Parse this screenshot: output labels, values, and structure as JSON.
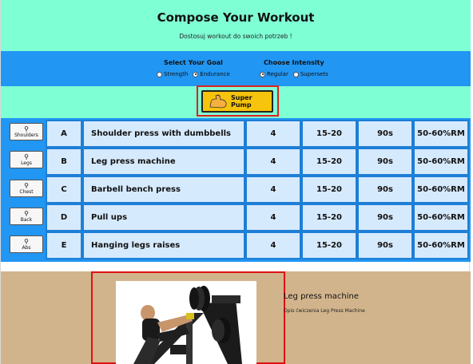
{
  "header": {
    "title": "Compose Your Workout",
    "subtitle": "Dostosuj workout do swoich potrzeb !"
  },
  "goal": {
    "title": "Select Your Goal",
    "options": [
      "Strength",
      "Endurance"
    ],
    "selected": "Endurance"
  },
  "intensity": {
    "title": "Choose Intensity",
    "options": [
      "Regular",
      "Supersets"
    ],
    "selected": "Regular"
  },
  "super_pump": {
    "label": "Super Pump",
    "icon": "flexed-biceps-icon"
  },
  "exercises": [
    {
      "muscle": "Shoulders",
      "letter": "A",
      "name": "Shoulder press with dumbbells",
      "sets": "4",
      "reps": "15-20",
      "rest": "90s",
      "load": "50-60%RM"
    },
    {
      "muscle": "Legs",
      "letter": "B",
      "name": "Leg press machine",
      "sets": "4",
      "reps": "15-20",
      "rest": "90s",
      "load": "50-60%RM"
    },
    {
      "muscle": "Chest",
      "letter": "C",
      "name": "Barbell bench press",
      "sets": "4",
      "reps": "15-20",
      "rest": "90s",
      "load": "50-60%RM"
    },
    {
      "muscle": "Back",
      "letter": "D",
      "name": "Pull ups",
      "sets": "4",
      "reps": "15-20",
      "rest": "90s",
      "load": "50-60%RM"
    },
    {
      "muscle": "Abs",
      "letter": "E",
      "name": "Hanging legs raises",
      "sets": "4",
      "reps": "15-20",
      "rest": "90s",
      "load": "50-60%RM"
    }
  ],
  "detail": {
    "title": "Leg press machine",
    "description": "Opis ćwiczenia Leg Press Machine"
  },
  "colors": {
    "aquamarine": "#7fffd4",
    "blue": "#2196f3",
    "cell": "#d6eafd",
    "tan": "#d2b48c",
    "pump": "#f6c40c",
    "highlight": "#e02020"
  }
}
